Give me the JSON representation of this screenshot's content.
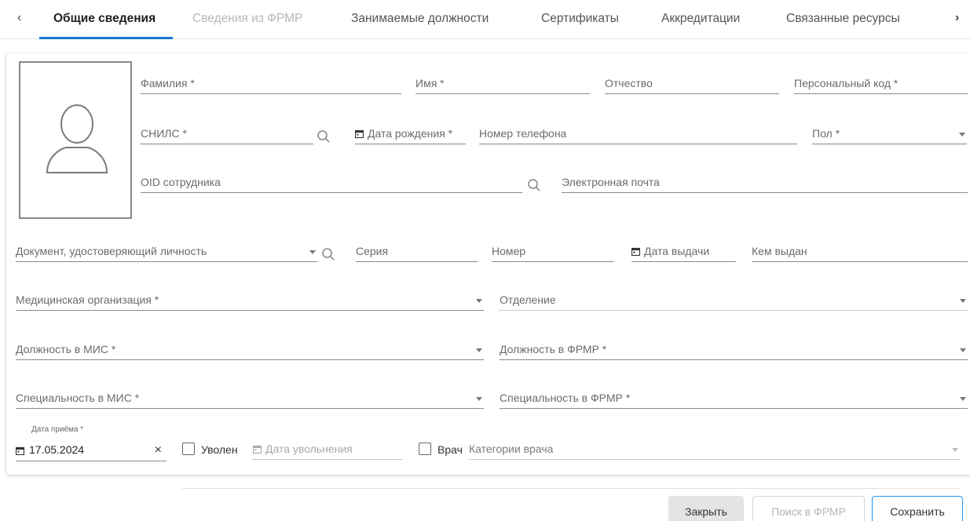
{
  "tabs": {
    "items": [
      {
        "label": "Общие сведения"
      },
      {
        "label": "Сведения из ФРМР"
      },
      {
        "label": "Занимаемые должности"
      },
      {
        "label": "Сертификаты"
      },
      {
        "label": "Аккредитации"
      },
      {
        "label": "Связанные ресурсы"
      }
    ],
    "prev_arrow": "‹",
    "next_arrow": "›"
  },
  "form": {
    "last_name": "Фамилия *",
    "first_name": "Имя *",
    "patronymic": "Отчество",
    "personal_code": "Персональный код *",
    "snils": "СНИЛС *",
    "birth_date": "Дата рождения *",
    "phone": "Номер телефона",
    "gender": "Пол *",
    "employee_oid": "OID сотрудника",
    "email": "Электронная почта",
    "id_document": "Документ, удостоверяющий личность",
    "series": "Серия",
    "number": "Номер",
    "issue_date": "Дата выдачи",
    "issued_by": "Кем выдан",
    "med_org": "Медицинская организация *",
    "department": "Отделение",
    "position_mis": "Должность в МИС *",
    "position_frmr": "Должность в ФРМР *",
    "specialty_mis": "Специальность в МИС *",
    "specialty_frmr": "Специальность в ФРМР *",
    "hire_date_label": "Дата приёма *",
    "hire_date_value": "17.05.2024",
    "dismissed_label": "Уволен",
    "dismissal_date": "Дата увольнения",
    "doctor_label": "Врач",
    "doctor_category": "Категории врача",
    "clear_symbol": "×"
  },
  "footer": {
    "close": "Закрыть",
    "search_frmr": "Поиск в ФРМР",
    "save": "Сохранить"
  },
  "colors": {
    "accent": "#1976d2",
    "save_border": "#2196f3",
    "close_bg": "#e4e4e4"
  }
}
